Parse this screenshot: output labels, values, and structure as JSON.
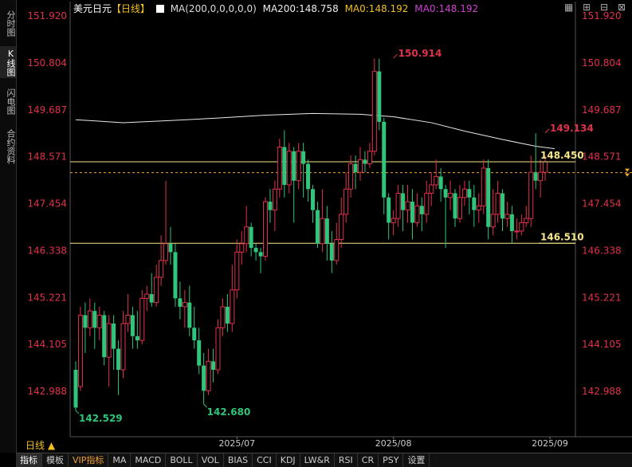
{
  "sidebar": {
    "tabs": [
      {
        "label": "分时图",
        "active": false
      },
      {
        "label": "K线图",
        "active": true
      },
      {
        "label": "闪电图",
        "active": false
      },
      {
        "label": "合约资料",
        "active": false
      }
    ]
  },
  "header": {
    "symbol": "美元日元",
    "period": "【日线】",
    "ma_label": "MA(200,0,0,0,0,0)",
    "ma200": "MA200:148.758",
    "ma0a": "MA0:148.192",
    "ma0b": "MA0:148.192"
  },
  "toolbar": {
    "grid_icon": "grid-icon",
    "plus_icon": "plus-icon",
    "minus_icon": "minus-icon",
    "close_icon": "close-icon"
  },
  "period_selector": {
    "label": "日线 ▲"
  },
  "bottom_tabs": [
    {
      "label": "指标",
      "active": true
    },
    {
      "label": "模板"
    },
    {
      "label": "VIP指标",
      "vip": true
    },
    {
      "label": "MA"
    },
    {
      "label": "MACD"
    },
    {
      "label": "BOLL"
    },
    {
      "label": "VOL"
    },
    {
      "label": "BIAS"
    },
    {
      "label": "CCI"
    },
    {
      "label": "KDJ"
    },
    {
      "label": "LW&R"
    },
    {
      "label": "RSI"
    },
    {
      "label": "CR"
    },
    {
      "label": "PSY"
    },
    {
      "label": "设置"
    }
  ],
  "colors": {
    "up": "#e0314a",
    "down": "#2fc57a",
    "ma200": "#e8e8e8",
    "hline": "#f5e68a",
    "dash": "#f0a830",
    "axis_text": "#e0314a",
    "date_text": "#cccccc"
  },
  "chart_data": {
    "type": "candlestick",
    "y_ticks": [
      "151.920",
      "150.804",
      "149.687",
      "148.571",
      "147.454",
      "146.338",
      "145.221",
      "144.105",
      "142.988"
    ],
    "y_tick_values": [
      151.92,
      150.804,
      149.687,
      148.571,
      147.454,
      146.338,
      145.221,
      144.105,
      142.988
    ],
    "ylim": [
      142.3,
      152.3
    ],
    "x_ticks": [
      {
        "label": "2025/07",
        "index": 34
      },
      {
        "label": "2025/08",
        "index": 67
      },
      {
        "label": "2025/09",
        "index": 100
      }
    ],
    "candles": [
      [
        143.5,
        142.6,
        143.7,
        142.53
      ],
      [
        143.1,
        144.8,
        145.0,
        143.0
      ],
      [
        144.8,
        144.5,
        145.1,
        143.9
      ],
      [
        144.5,
        144.9,
        145.2,
        144.3
      ],
      [
        144.9,
        144.5,
        145.1,
        144.0
      ],
      [
        144.5,
        144.8,
        145.0,
        144.2
      ],
      [
        144.8,
        143.8,
        144.9,
        143.6
      ],
      [
        143.8,
        144.6,
        144.8,
        143.1
      ],
      [
        144.6,
        144.0,
        144.8,
        143.5
      ],
      [
        144.0,
        143.5,
        144.2,
        142.9
      ],
      [
        143.5,
        144.6,
        144.9,
        143.3
      ],
      [
        144.6,
        144.8,
        145.3,
        144.4
      ],
      [
        144.8,
        144.3,
        145.0,
        144.0
      ],
      [
        144.3,
        144.2,
        144.9,
        144.0
      ],
      [
        144.2,
        145.2,
        145.4,
        144.1
      ],
      [
        145.2,
        145.3,
        145.5,
        144.9
      ],
      [
        145.3,
        145.1,
        145.8,
        145.0
      ],
      [
        145.1,
        145.7,
        146.0,
        145.0
      ],
      [
        145.7,
        146.1,
        146.7,
        145.5
      ],
      [
        146.1,
        146.5,
        148.0,
        146.0
      ],
      [
        146.5,
        146.3,
        146.9,
        146.0
      ],
      [
        146.3,
        145.2,
        146.5,
        145.0
      ],
      [
        145.2,
        145.0,
        145.6,
        144.7
      ],
      [
        145.0,
        145.1,
        145.4,
        144.5
      ],
      [
        145.1,
        144.5,
        145.5,
        144.3
      ],
      [
        144.5,
        144.2,
        145.0,
        144.0
      ],
      [
        144.2,
        143.6,
        144.5,
        143.4
      ],
      [
        143.6,
        143.0,
        143.9,
        142.68
      ],
      [
        143.0,
        143.7,
        144.0,
        142.9
      ],
      [
        143.7,
        143.5,
        144.0,
        143.2
      ],
      [
        143.5,
        144.5,
        144.7,
        143.4
      ],
      [
        144.5,
        145.0,
        145.2,
        144.3
      ],
      [
        145.0,
        144.6,
        145.3,
        144.4
      ],
      [
        144.6,
        145.4,
        146.0,
        144.4
      ],
      [
        145.4,
        146.3,
        146.6,
        145.2
      ],
      [
        146.3,
        146.5,
        146.8,
        146.0
      ],
      [
        146.5,
        146.9,
        147.4,
        146.3
      ],
      [
        146.9,
        146.4,
        147.0,
        146.2
      ],
      [
        146.4,
        146.3,
        146.5,
        146.1
      ],
      [
        146.3,
        146.2,
        146.4,
        145.8
      ],
      [
        146.2,
        147.5,
        147.6,
        146.1
      ],
      [
        147.5,
        147.3,
        147.8,
        147.0
      ],
      [
        147.3,
        147.8,
        148.0,
        146.8
      ],
      [
        147.8,
        148.8,
        149.0,
        147.6
      ],
      [
        148.8,
        147.9,
        149.2,
        147.6
      ],
      [
        147.9,
        148.7,
        148.9,
        147.7
      ],
      [
        148.7,
        148.0,
        148.8,
        147.0
      ],
      [
        148.0,
        148.7,
        148.9,
        147.8
      ],
      [
        148.7,
        148.4,
        148.9,
        147.6
      ],
      [
        148.4,
        147.8,
        148.5,
        147.5
      ],
      [
        147.8,
        147.3,
        147.9,
        147.0
      ],
      [
        147.3,
        146.5,
        147.5,
        146.4
      ],
      [
        146.5,
        147.1,
        147.8,
        146.3
      ],
      [
        147.1,
        146.5,
        147.4,
        146.1
      ],
      [
        146.5,
        146.1,
        146.8,
        145.8
      ],
      [
        146.1,
        146.6,
        147.0,
        146.0
      ],
      [
        146.6,
        147.2,
        147.6,
        146.4
      ],
      [
        147.2,
        147.8,
        148.2,
        147.0
      ],
      [
        147.8,
        148.4,
        148.6,
        147.6
      ],
      [
        148.4,
        148.2,
        148.6,
        147.8
      ],
      [
        148.2,
        148.5,
        148.8,
        148.0
      ],
      [
        148.5,
        148.4,
        148.7,
        148.2
      ],
      [
        148.4,
        148.7,
        148.9,
        148.3
      ],
      [
        148.7,
        150.6,
        150.91,
        148.6
      ],
      [
        150.6,
        149.4,
        150.9,
        149.2
      ],
      [
        149.4,
        147.6,
        149.5,
        147.2
      ],
      [
        147.6,
        147.0,
        147.7,
        146.6
      ],
      [
        147.0,
        147.1,
        147.3,
        146.7
      ],
      [
        147.1,
        147.7,
        147.9,
        146.9
      ],
      [
        147.7,
        147.3,
        147.9,
        146.8
      ],
      [
        147.3,
        147.5,
        147.9,
        147.0
      ],
      [
        147.5,
        147.0,
        147.8,
        146.6
      ],
      [
        147.0,
        147.4,
        147.7,
        146.9
      ],
      [
        147.4,
        147.2,
        147.6,
        146.8
      ],
      [
        147.2,
        147.7,
        148.0,
        147.0
      ],
      [
        147.7,
        147.9,
        148.2,
        147.4
      ],
      [
        147.9,
        148.1,
        148.5,
        147.8
      ],
      [
        148.1,
        147.8,
        148.3,
        147.5
      ],
      [
        147.8,
        147.6,
        147.9,
        146.4
      ],
      [
        147.6,
        147.7,
        148.0,
        147.3
      ],
      [
        147.7,
        147.1,
        147.8,
        146.9
      ],
      [
        147.1,
        147.6,
        147.9,
        147.0
      ],
      [
        147.6,
        147.8,
        148.0,
        147.4
      ],
      [
        147.8,
        147.6,
        148.0,
        147.2
      ],
      [
        147.6,
        147.3,
        147.9,
        146.9
      ],
      [
        147.3,
        147.4,
        147.7,
        147.0
      ],
      [
        147.4,
        148.3,
        148.5,
        147.2
      ],
      [
        148.3,
        146.9,
        148.5,
        146.6
      ],
      [
        146.9,
        147.2,
        147.8,
        146.7
      ],
      [
        147.2,
        147.7,
        148.0,
        147.0
      ],
      [
        147.7,
        147.1,
        147.8,
        146.8
      ],
      [
        147.1,
        147.2,
        147.5,
        146.9
      ],
      [
        147.2,
        146.8,
        147.4,
        146.5
      ],
      [
        146.8,
        146.8,
        147.1,
        146.6
      ],
      [
        146.8,
        147.0,
        147.2,
        146.7
      ],
      [
        147.0,
        147.1,
        147.4,
        146.9
      ],
      [
        147.1,
        148.2,
        148.6,
        146.9
      ],
      [
        148.2,
        148.0,
        149.13,
        147.8
      ],
      [
        148.0,
        148.2,
        148.5,
        147.6
      ],
      [
        148.2,
        148.45,
        148.6,
        148.0
      ]
    ],
    "ma200": [
      [
        0,
        149.45
      ],
      [
        10,
        149.38
      ],
      [
        20,
        149.43
      ],
      [
        30,
        149.49
      ],
      [
        40,
        149.56
      ],
      [
        50,
        149.6
      ],
      [
        60,
        149.58
      ],
      [
        67,
        149.52
      ],
      [
        75,
        149.38
      ],
      [
        82,
        149.18
      ],
      [
        90,
        148.98
      ],
      [
        97,
        148.82
      ],
      [
        101,
        148.76
      ]
    ],
    "hlines": [
      148.45,
      146.51
    ],
    "dashed_line": 148.192,
    "annotations": [
      {
        "label": "150.914",
        "index": 67,
        "value": 150.914,
        "color": "up"
      },
      {
        "label": "149.134",
        "index": 99,
        "value": 149.134,
        "color": "up"
      },
      {
        "label": "148.450",
        "index": 101,
        "value": 148.45,
        "color": "hline"
      },
      {
        "label": "146.510",
        "index": 101,
        "value": 146.51,
        "color": "hline"
      },
      {
        "label": "142.529",
        "index": 0,
        "value": 142.529,
        "color": "down"
      },
      {
        "label": "142.680",
        "index": 27,
        "value": 142.68,
        "color": "down"
      }
    ]
  }
}
